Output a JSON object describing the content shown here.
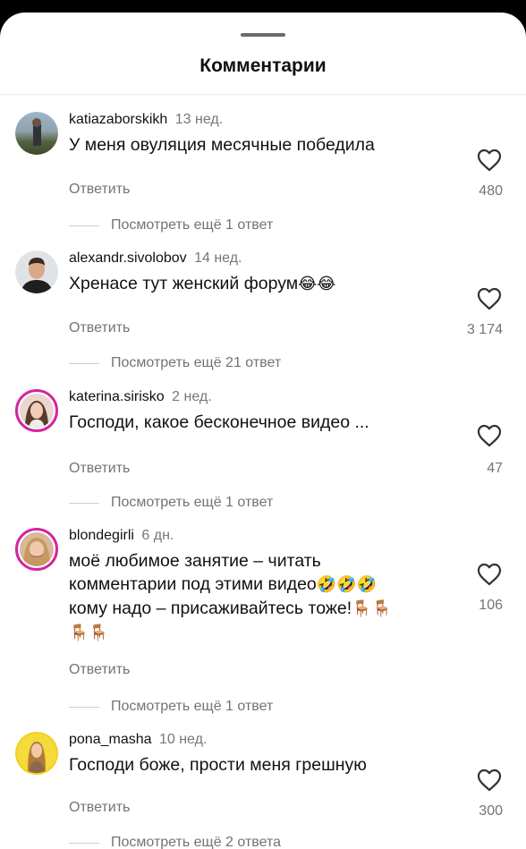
{
  "sheet": {
    "title": "Комментарии"
  },
  "comments": [
    {
      "username": "katiazaborskikh",
      "time": "13 нед.",
      "text": "У меня овуляция месячные победила",
      "reply_label": "Ответить",
      "likes": "480",
      "view_more": "Посмотреть ещё 1 ответ"
    },
    {
      "username": "alexandr.sivolobov",
      "time": "14 нед.",
      "text": "Хренасе тут женский форум",
      "emojis": "😂😂",
      "reply_label": "Ответить",
      "likes": "3 174",
      "view_more": "Посмотреть ещё 21 ответ"
    },
    {
      "username": "katerina.sirisko",
      "time": "2 нед.",
      "text": "Господи, какое бесконечное видео ...",
      "reply_label": "Ответить",
      "likes": "47",
      "view_more": "Посмотреть ещё 1 ответ"
    },
    {
      "username": "blondegirli",
      "time": "6 дн.",
      "text_line1": "моё любимое занятие – читать",
      "text_line2": "комментарии под этими видео",
      "text_line2_emojis": "🤣🤣🤣",
      "text_line3": "кому надо – присаживайтесь тоже!",
      "text_line3_emojis": "🪑🪑",
      "text_line4_emojis": "🪑🪑",
      "reply_label": "Ответить",
      "likes": "106",
      "view_more": "Посмотреть ещё 1 ответ"
    },
    {
      "username": "pona_masha",
      "time": "10 нед.",
      "text": "Господи боже, прости меня грешную",
      "reply_label": "Ответить",
      "likes": "300",
      "view_more": "Посмотреть ещё 2 ответа"
    }
  ]
}
